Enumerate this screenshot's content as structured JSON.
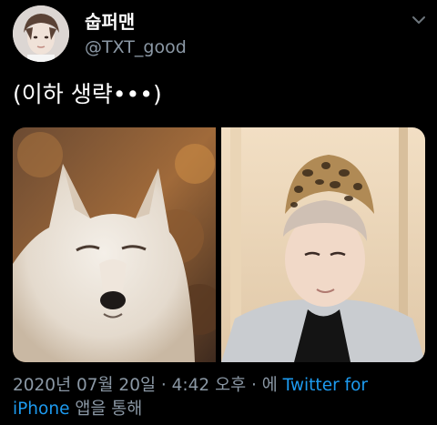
{
  "tweet": {
    "display_name": "숩퍼맨",
    "handle": "@TXT_good",
    "text": "(이하 생략•••)",
    "meta": {
      "date": "2020년 07월 20일",
      "sep1": " · ",
      "time": "4:42 오후",
      "sep2": " · ",
      "via_prefix": "에 ",
      "source_line1": "Twitter for",
      "source_line2": "iPhone",
      "via_suffix": " 앱을 통해"
    }
  },
  "colors": {
    "background": "#000000",
    "text_primary": "#ffffff",
    "text_secondary": "#8b98a5",
    "link": "#1d9bf0"
  },
  "icons": {
    "more": "chevron-down-icon"
  }
}
